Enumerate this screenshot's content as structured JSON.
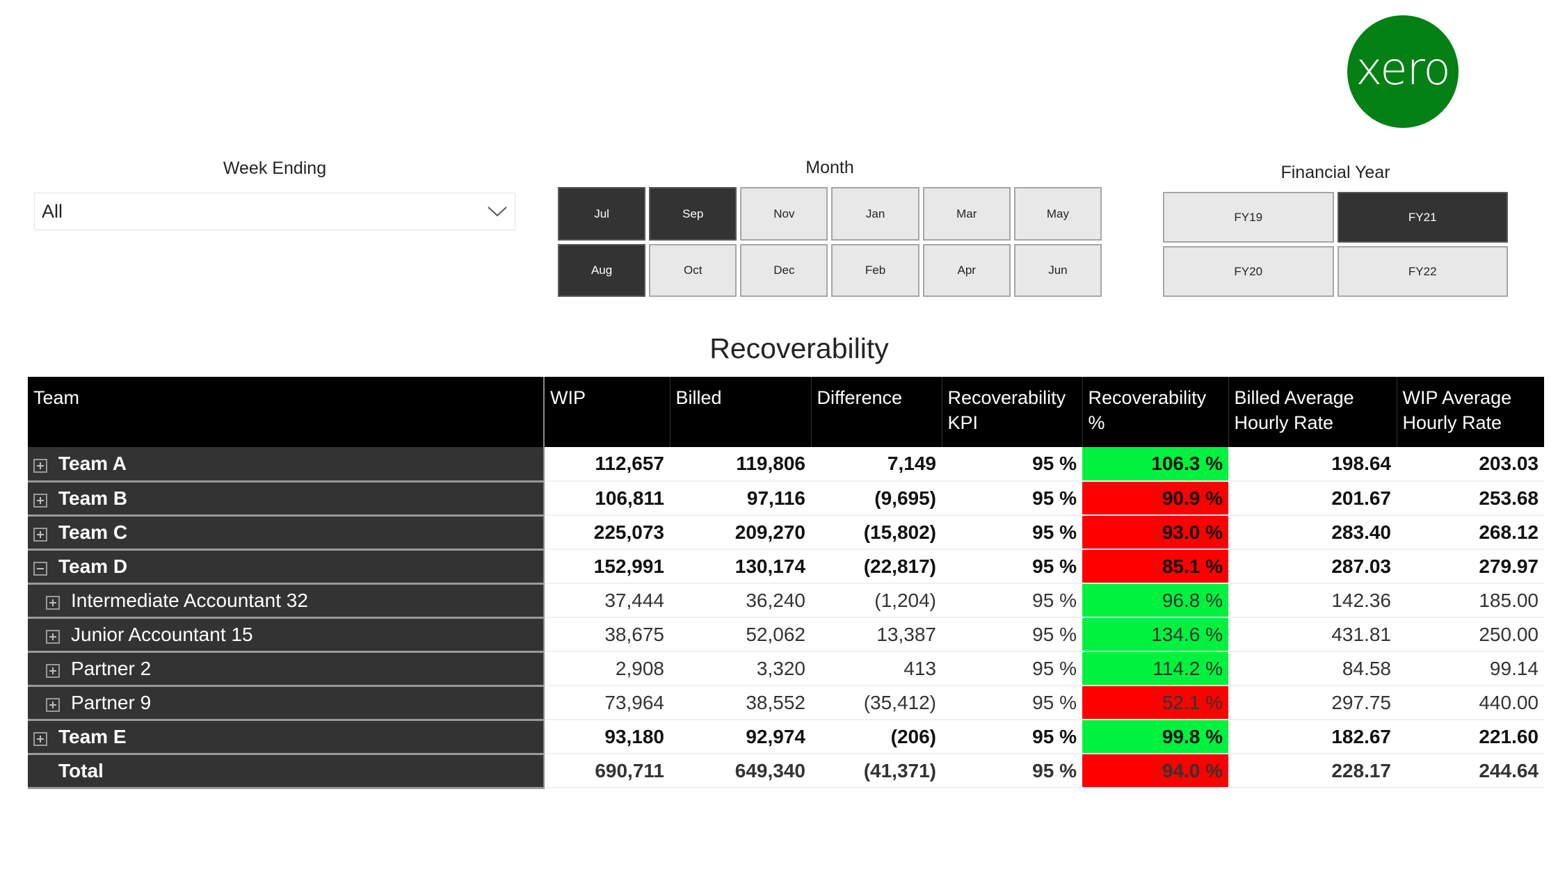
{
  "logo": {
    "text": "xero",
    "color": "#058014"
  },
  "week_ending": {
    "label": "Week Ending",
    "value": "All"
  },
  "month": {
    "label": "Month",
    "options": [
      {
        "label": "Jul",
        "selected": true
      },
      {
        "label": "Sep",
        "selected": true
      },
      {
        "label": "Nov",
        "selected": false
      },
      {
        "label": "Jan",
        "selected": false
      },
      {
        "label": "Mar",
        "selected": false
      },
      {
        "label": "May",
        "selected": false
      },
      {
        "label": "Aug",
        "selected": true
      },
      {
        "label": "Oct",
        "selected": false
      },
      {
        "label": "Dec",
        "selected": false
      },
      {
        "label": "Feb",
        "selected": false
      },
      {
        "label": "Apr",
        "selected": false
      },
      {
        "label": "Jun",
        "selected": false
      }
    ]
  },
  "financial_year": {
    "label": "Financial Year",
    "options": [
      {
        "label": "FY19",
        "selected": false
      },
      {
        "label": "FY21",
        "selected": true
      },
      {
        "label": "FY20",
        "selected": false
      },
      {
        "label": "FY22",
        "selected": false
      }
    ]
  },
  "table": {
    "title": "Recoverability",
    "columns": [
      "Team",
      "WIP",
      "Billed",
      "Difference",
      "Recoverability KPI",
      "Recoverability %",
      "Billed Average Hourly Rate",
      "WIP Average Hourly Rate"
    ],
    "status_colors": {
      "good": "#00f23f",
      "bad": "#fe0000"
    },
    "rows": [
      {
        "team": "Team A",
        "level": 0,
        "expand": "plus",
        "wip": "112,657",
        "billed": "119,806",
        "difference": "7,149",
        "kpi": "95 %",
        "rec_pct": "106.3 %",
        "status": "good",
        "billed_avg": "198.64",
        "wip_avg": "203.03"
      },
      {
        "team": "Team B",
        "level": 0,
        "expand": "plus",
        "wip": "106,811",
        "billed": "97,116",
        "difference": "(9,695)",
        "kpi": "95 %",
        "rec_pct": "90.9 %",
        "status": "bad",
        "billed_avg": "201.67",
        "wip_avg": "253.68"
      },
      {
        "team": "Team C",
        "level": 0,
        "expand": "plus",
        "wip": "225,073",
        "billed": "209,270",
        "difference": "(15,802)",
        "kpi": "95 %",
        "rec_pct": "93.0 %",
        "status": "bad",
        "billed_avg": "283.40",
        "wip_avg": "268.12"
      },
      {
        "team": "Team D",
        "level": 0,
        "expand": "minus",
        "wip": "152,991",
        "billed": "130,174",
        "difference": "(22,817)",
        "kpi": "95 %",
        "rec_pct": "85.1 %",
        "status": "bad",
        "billed_avg": "287.03",
        "wip_avg": "279.97"
      },
      {
        "team": "Intermediate Accountant 32",
        "level": 1,
        "expand": "plus",
        "wip": "37,444",
        "billed": "36,240",
        "difference": "(1,204)",
        "kpi": "95 %",
        "rec_pct": "96.8 %",
        "status": "good",
        "billed_avg": "142.36",
        "wip_avg": "185.00"
      },
      {
        "team": "Junior Accountant 15",
        "level": 1,
        "expand": "plus",
        "wip": "38,675",
        "billed": "52,062",
        "difference": "13,387",
        "kpi": "95 %",
        "rec_pct": "134.6 %",
        "status": "good",
        "billed_avg": "431.81",
        "wip_avg": "250.00"
      },
      {
        "team": "Partner 2",
        "level": 1,
        "expand": "plus",
        "wip": "2,908",
        "billed": "3,320",
        "difference": "413",
        "kpi": "95 %",
        "rec_pct": "114.2 %",
        "status": "good",
        "billed_avg": "84.58",
        "wip_avg": "99.14"
      },
      {
        "team": "Partner 9",
        "level": 1,
        "expand": "plus",
        "wip": "73,964",
        "billed": "38,552",
        "difference": "(35,412)",
        "kpi": "95 %",
        "rec_pct": "52.1 %",
        "status": "bad",
        "billed_avg": "297.75",
        "wip_avg": "440.00"
      },
      {
        "team": "Team E",
        "level": 0,
        "expand": "plus",
        "wip": "93,180",
        "billed": "92,974",
        "difference": "(206)",
        "kpi": "95 %",
        "rec_pct": "99.8 %",
        "status": "good",
        "billed_avg": "182.67",
        "wip_avg": "221.60"
      }
    ],
    "total": {
      "team": "Total",
      "wip": "690,711",
      "billed": "649,340",
      "difference": "(41,371)",
      "kpi": "95 %",
      "rec_pct": "94.0 %",
      "status": "bad",
      "billed_avg": "228.17",
      "wip_avg": "244.64"
    }
  }
}
